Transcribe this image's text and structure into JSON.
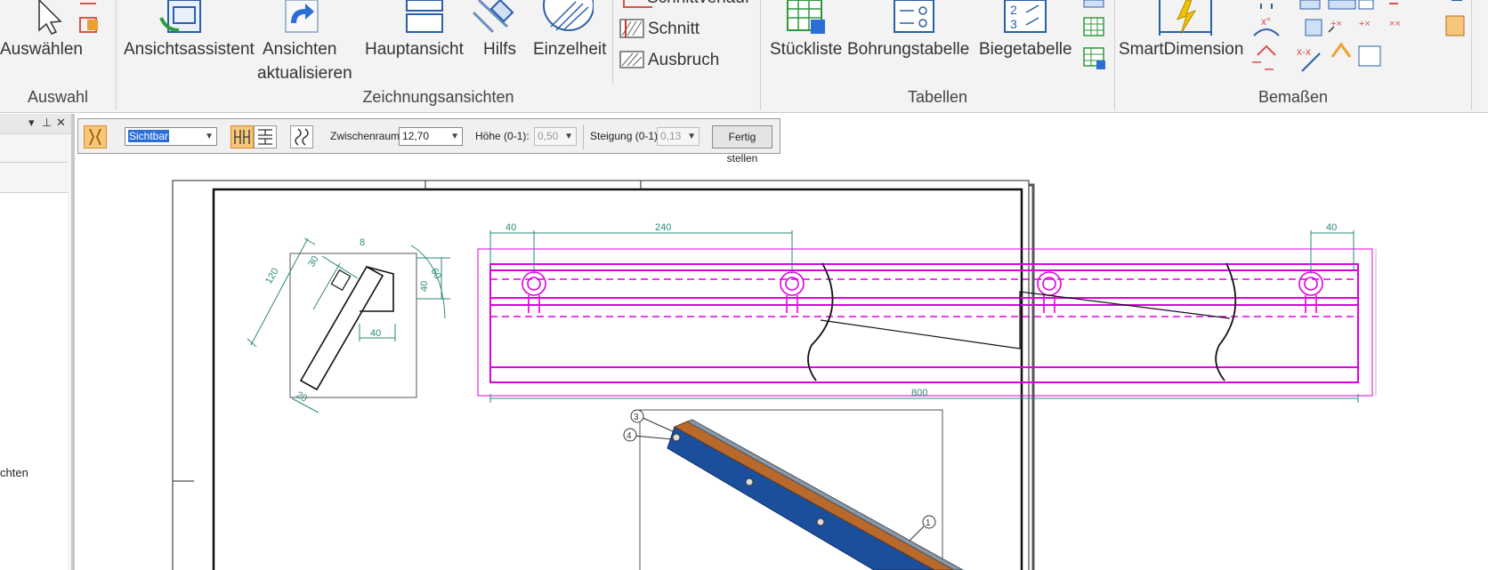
{
  "ribbon": {
    "groups": {
      "auswahl": "Auswahl",
      "zeichnungsansichten": "Zeichnungsansichten",
      "tabellen": "Tabellen",
      "bemassen": "Bemaßen"
    },
    "buttons": {
      "auswaehlen": "Auswählen",
      "ansichtsassistent": "Ansichtsassistent",
      "ansichten_line1": "Ansichten",
      "ansichten_line2": "aktualisieren",
      "hauptansicht": "Hauptansicht",
      "hilfs": "Hilfs",
      "einzelheit": "Einzelheit",
      "schnittverlauf": "Schnittverlauf",
      "schnitt": "Schnitt",
      "ausbruch": "Ausbruch",
      "stueckliste": "Stückliste",
      "bohrungstabelle": "Bohrungstabelle",
      "biegetabelle": "Biegetabelle",
      "smartdimension": "SmartDimension"
    }
  },
  "left_panel": {
    "tree_text": "chten"
  },
  "command_bar": {
    "display_mode": "Sichtbar",
    "gap_label": "Zwischenraum:",
    "gap_value": "12,70",
    "height_label": "Höhe (0-1):",
    "height_value": "0,50",
    "slope_label": "Steigung (0-1):",
    "slope_value": "0,13",
    "finish_label": "Fertig stellen"
  },
  "drawing": {
    "dims": {
      "top_left": "40",
      "top_mid": "240",
      "top_right": "40",
      "bottom_total": "800",
      "side_120": "120",
      "side_30": "30",
      "side_8": "8",
      "side_60": "60",
      "side_40v": "40",
      "side_40h": "40",
      "side_20": "20"
    },
    "balloons": {
      "b3": "3",
      "b4": "4",
      "b1": "1"
    }
  },
  "colors": {
    "accent_orange": "#f6c77a",
    "dimension": "#2a8a7a",
    "highlight_magenta": "#e000e0",
    "iso_blue": "#1b4f9c",
    "iso_brown": "#b8692b"
  }
}
